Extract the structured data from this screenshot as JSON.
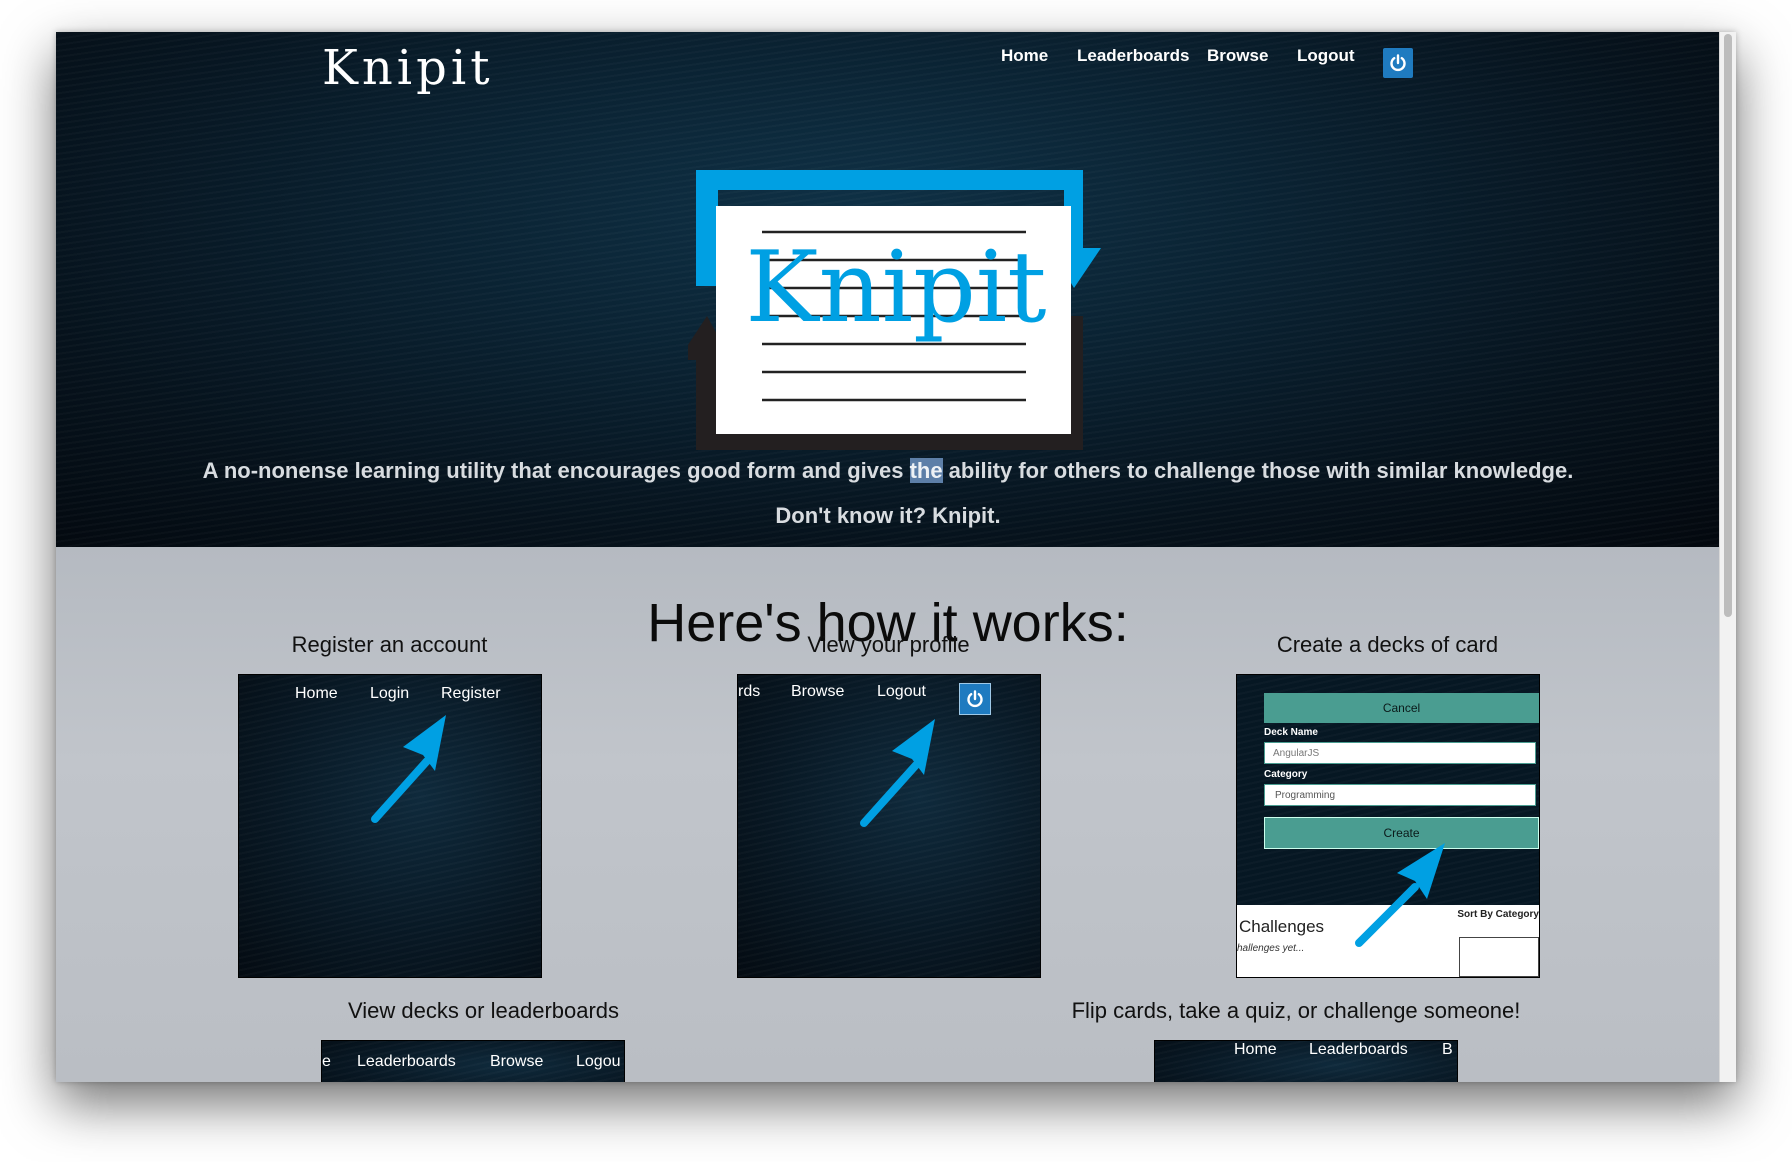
{
  "header": {
    "brand": "Knipit",
    "nav": [
      "Home",
      "Leaderboards",
      "Browse",
      "Logout"
    ],
    "power_icon": "power-icon"
  },
  "hero": {
    "logo_text": "Knipit",
    "tagline_before": "A no-nonense learning utility that encourages good form and gives ",
    "tagline_highlight": "the",
    "tagline_after": " ability for others to challenge those with similar knowledge.",
    "slogan": "Don't know it? Knipit."
  },
  "how": {
    "heading": "Here's how it works:",
    "steps": [
      {
        "title": "Register an account",
        "nav": [
          "Home",
          "Login",
          "Register"
        ]
      },
      {
        "title": "View your profile",
        "nav": [
          "rds",
          "Browse",
          "Logout"
        ]
      },
      {
        "title": "Create a decks of card",
        "cancel_label": "Cancel",
        "deck_name_label": "Deck Name",
        "deck_name_value": "AngularJS",
        "category_label": "Category",
        "category_value": "Programming",
        "create_label": "Create",
        "challenges_label": "Challenges",
        "no_challenges": "hallenges yet...",
        "sort_label": "Sort By Category"
      },
      {
        "title": "View decks or leaderboards",
        "nav": [
          "e",
          "Leaderboards",
          "Browse",
          "Logou"
        ]
      },
      {
        "title": "Flip cards, take a quiz, or challenge someone!",
        "nav": [
          "Home",
          "Leaderboards",
          "B"
        ]
      }
    ]
  },
  "colors": {
    "accent_blue": "#00a0e3",
    "teal": "#4a9d91",
    "power_blue": "#1f7bc0",
    "logo_dark": "#231f20"
  }
}
